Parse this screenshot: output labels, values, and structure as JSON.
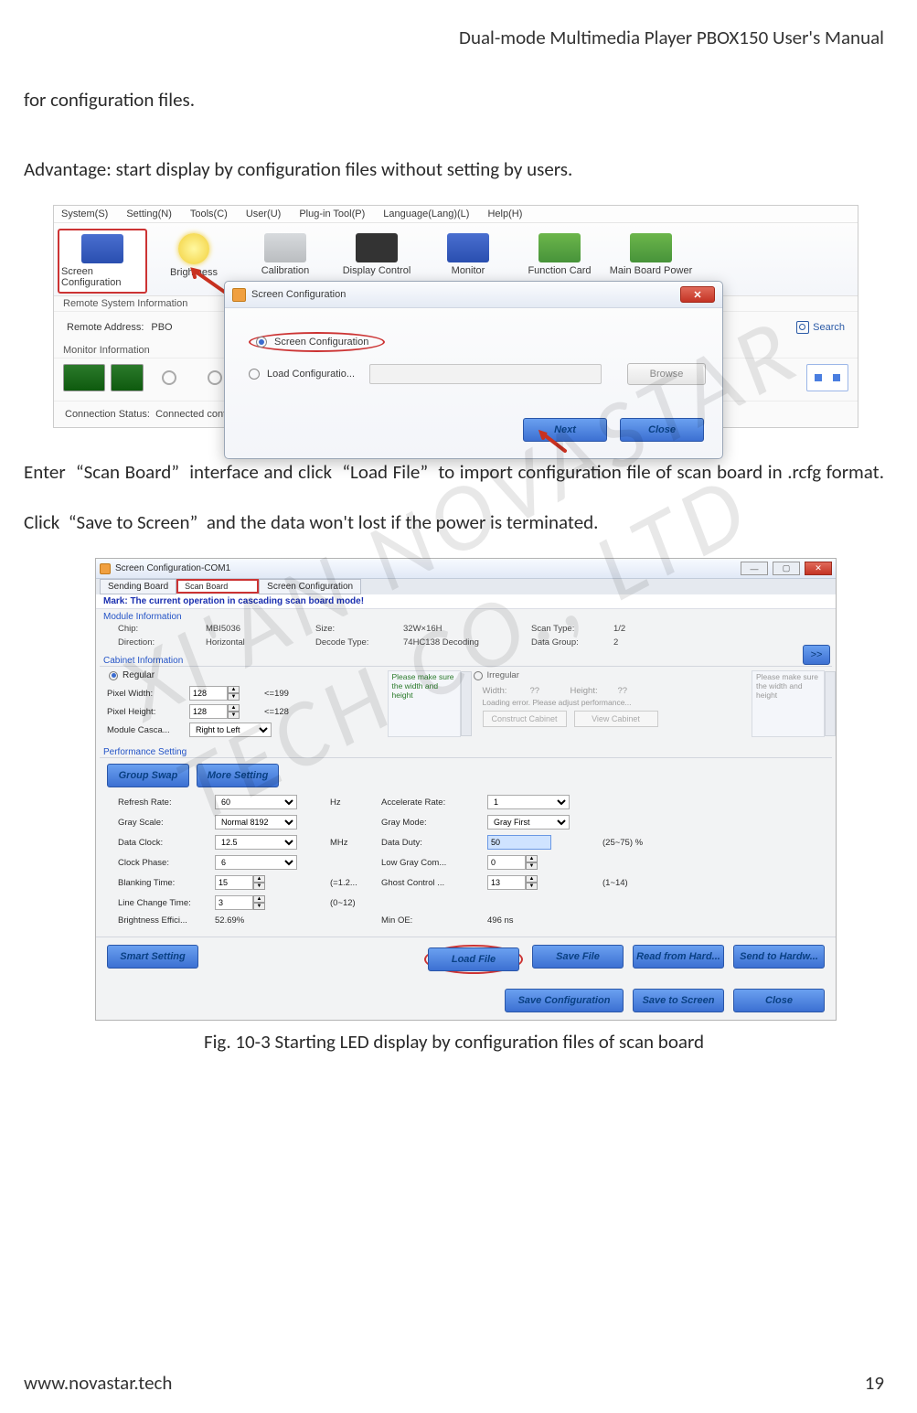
{
  "header": {
    "title": "Dual-mode Multimedia Player PBOX150 User's Manual"
  },
  "paragraphs": {
    "p1": "for configuration files.",
    "p2": "Advantage: start display by configuration files without setting by users.",
    "p3": "Enter  “Scan Board”  interface and click  “Load File”  to import configuration file of scan board in .rcfg format. Click  “Save to Screen”  and the data won't lost if the power is terminated."
  },
  "figcaption": "Fig. 10-3 Starting LED display by configuration files of scan board",
  "footer": {
    "site": "www.novastar.tech",
    "page": "19"
  },
  "watermark": "XI'AN NOVASTAR TECH CO., LTD",
  "shot1": {
    "menubar": [
      "System(S)",
      "Setting(N)",
      "Tools(C)",
      "User(U)",
      "Plug-in Tool(P)",
      "Language(Lang)(L)",
      "Help(H)"
    ],
    "toolbar": [
      "Screen Configuration",
      "Brightness",
      "Calibration",
      "Display Control",
      "Monitor",
      "Function Card",
      "Main Board Power"
    ],
    "remote_sys_label": "Remote System Information",
    "remote_addr_label": "Remote Address:",
    "remote_addr_value": "PBO",
    "search": "Search",
    "monitor_info_label": "Monitor Information",
    "conn_label": "Connection Status:",
    "conn_value": "Connected control card",
    "dialog": {
      "title": "Screen Configuration",
      "opt1": "Screen Configuration",
      "opt2": "Load Configuratio...",
      "browse": "Browse",
      "next": "Next",
      "close": "Close"
    }
  },
  "shot2": {
    "wintitle": "Screen Configuration-COM1",
    "tabs": [
      "Sending Board",
      "Scan Board",
      "Screen Configuration"
    ],
    "mark": "Mark: The current operation in cascading scan board mode!",
    "sec_module": "Module Information",
    "module": {
      "chip_l": "Chip:",
      "chip_v": "MBI5036",
      "size_l": "Size:",
      "size_v": "32W×16H",
      "scan_l": "Scan Type:",
      "scan_v": "1/2",
      "dir_l": "Direction:",
      "dir_v": "Horizontal",
      "dec_l": "Decode Type:",
      "dec_v": "74HC138 Decoding",
      "dg_l": "Data Group:",
      "dg_v": "2",
      "arrow": ">>"
    },
    "sec_cabinet": "Cabinet Information",
    "cabinet": {
      "regular": "Regular",
      "irregular": "Irregular",
      "pw_l": "Pixel Width:",
      "pw_v": "128",
      "pw_hint": "<=199",
      "ph_l": "Pixel Height:",
      "ph_v": "128",
      "ph_hint": "<=128",
      "mc_l": "Module Casca...",
      "mc_v": "Right to Left",
      "hint": "Please make sure the width and height",
      "irr_w": "Width:",
      "irr_wv": "??",
      "irr_h": "Height:",
      "irr_hv": "??",
      "irr_err": "Loading error. Please adjust performance...",
      "construct": "Construct Cabinet",
      "view": "View Cabinet"
    },
    "sec_perf": "Performance Setting",
    "perf_btns": {
      "gs": "Group Swap",
      "ms": "More Setting"
    },
    "perf": {
      "rr_l": "Refresh Rate:",
      "rr_v": "60",
      "rr_u": "Hz",
      "ar_l": "Accelerate Rate:",
      "ar_v": "1",
      "gs_l": "Gray Scale:",
      "gs_v": "Normal 8192",
      "gm_l": "Gray Mode:",
      "gm_v": "Gray First",
      "dc_l": "Data Clock:",
      "dc_v": "12.5",
      "dc_u": "MHz",
      "dd_l": "Data Duty:",
      "dd_v": "50",
      "dd_u": "(25~75) %",
      "cp_l": "Clock Phase:",
      "cp_v": "6",
      "lg_l": "Low Gray Com...",
      "lg_v": "0",
      "bt_l": "Blanking Time:",
      "bt_v": "15",
      "bt_u": "(=1.2...",
      "gc_l": "Ghost Control ...",
      "gc_v": "13",
      "gc_u": "(1~14)",
      "lct_l": "Line Change Time:",
      "lct_v": "3",
      "lct_u": "(0~12)",
      "be_l": "Brightness Effici...",
      "be_v": "52.69%",
      "moe_l": "Min OE:",
      "moe_v": "496 ns"
    },
    "bottom": {
      "smart": "Smart Setting",
      "load": "Load File",
      "save": "Save File",
      "readhw": "Read from Hard...",
      "sendhw": "Send to Hardw...",
      "savecfg": "Save Configuration",
      "savescr": "Save to Screen",
      "close": "Close"
    }
  }
}
